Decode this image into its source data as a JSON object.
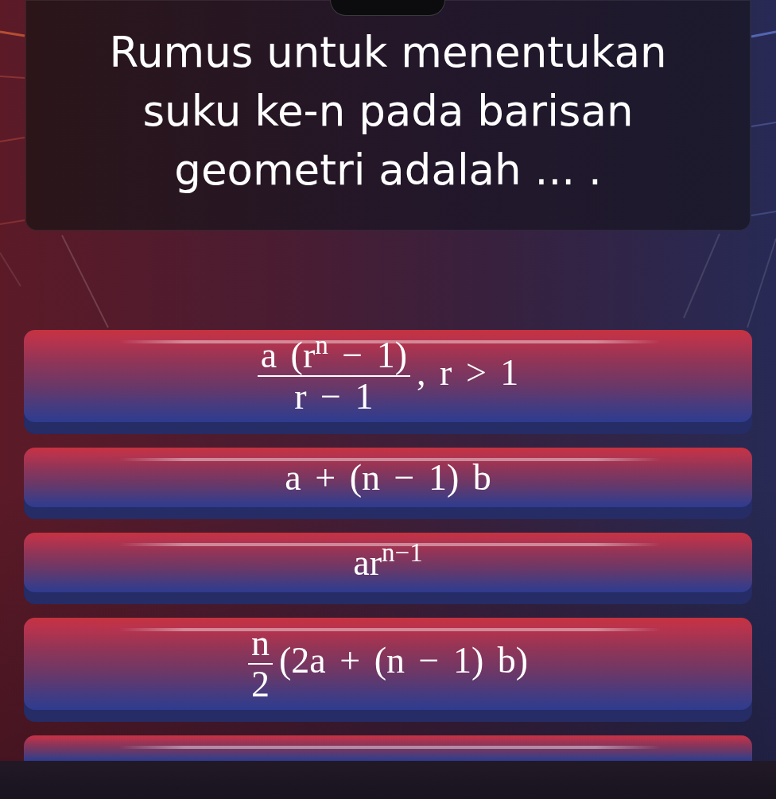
{
  "question": {
    "text": "Rumus untuk menentukan suku ke-n pada barisan geometri adalah ... ."
  },
  "options": [
    {
      "kind": "fraction",
      "numerator": "a (r$^{n}$ − 1)",
      "denominator": "r − 1",
      "trailing": ", r > 1"
    },
    {
      "kind": "inline",
      "text": "a + (n − 1) b"
    },
    {
      "kind": "inline",
      "text": "ar$^{n−1}$"
    },
    {
      "kind": "fraction",
      "numerator": "n",
      "denominator": "2",
      "trailing": "(2a + (n − 1) b)"
    },
    {
      "kind": "cut_off"
    }
  ]
}
